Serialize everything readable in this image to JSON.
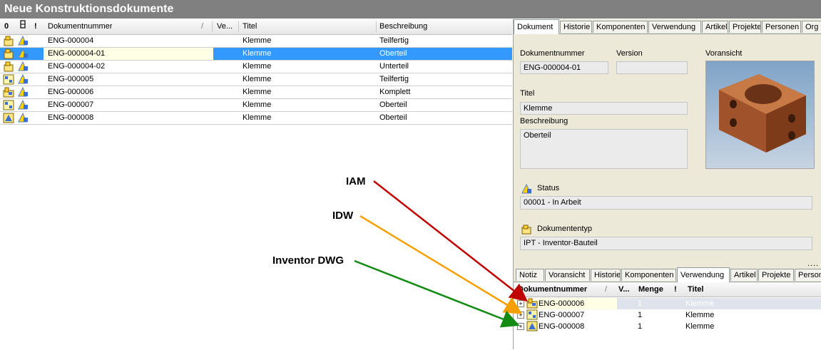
{
  "window": {
    "title": "Neue Konstruktionsdokumente"
  },
  "grid": {
    "headers": {
      "doknr": "Dokumentnummer",
      "version": "Ve...",
      "titel": "Titel",
      "beschreibung": "Beschreibung"
    },
    "rows": [
      {
        "doknr": "ENG-000004",
        "titel": "Klemme",
        "beschreibung": "Teilfertig",
        "type_icon": "ipt-part-icon",
        "status_icon": "status-in-work-icon",
        "selected": false
      },
      {
        "doknr": "ENG-000004-01",
        "titel": "Klemme",
        "beschreibung": "Oberteil",
        "type_icon": "ipt-part-icon",
        "status_icon": "status-in-work-icon",
        "selected": true
      },
      {
        "doknr": "ENG-000004-02",
        "titel": "Klemme",
        "beschreibung": "Unterteil",
        "type_icon": "ipt-part-icon",
        "status_icon": "status-in-work-icon",
        "selected": false
      },
      {
        "doknr": "ENG-000005",
        "titel": "Klemme",
        "beschreibung": "Teilfertig",
        "type_icon": "idw-drawing-icon",
        "status_icon": "status-in-work-icon",
        "selected": false
      },
      {
        "doknr": "ENG-000006",
        "titel": "Klemme",
        "beschreibung": "Komplett",
        "type_icon": "iam-assembly-icon",
        "status_icon": "status-in-work-icon",
        "selected": false
      },
      {
        "doknr": "ENG-000007",
        "titel": "Klemme",
        "beschreibung": "Oberteil",
        "type_icon": "idw-drawing-icon",
        "status_icon": "status-in-work-icon",
        "selected": false
      },
      {
        "doknr": "ENG-000008",
        "titel": "Klemme",
        "beschreibung": "Oberteil",
        "type_icon": "dwg-drawing-icon",
        "status_icon": "status-in-work-icon",
        "selected": false
      }
    ]
  },
  "top_tabs": [
    "Dokument",
    "Historie",
    "Komponenten",
    "Verwendung",
    "Artikel",
    "Projekte",
    "Personen",
    "Org"
  ],
  "detail": {
    "doknr_label": "Dokumentnummer",
    "doknr_value": "ENG-000004-01",
    "version_label": "Version",
    "version_value": "",
    "preview_label": "Voransicht",
    "titel_label": "Titel",
    "titel_value": "Klemme",
    "beschreibung_label": "Beschreibung",
    "beschreibung_value": "Oberteil",
    "status_label": "Status",
    "status_value": "00001 - In Arbeit",
    "doktyp_label": "Dokumententyp",
    "doktyp_value": "IPT - Inventor-Bauteil",
    "splitter": "...."
  },
  "bottom_tabs": [
    "Notiz",
    "Voransicht",
    "Historie",
    "Komponenten",
    "Verwendung",
    "Artikel",
    "Projekte",
    "Person"
  ],
  "usage": {
    "headers": {
      "doknr": "Dokumentnummer",
      "version": "V...",
      "menge": "Menge",
      "titel": "Titel"
    },
    "rows": [
      {
        "doknr": "ENG-000006",
        "menge": "1",
        "titel": "Klemme",
        "icon": "iam-assembly-icon",
        "selected": true
      },
      {
        "doknr": "ENG-000007",
        "menge": "1",
        "titel": "Klemme",
        "icon": "idw-drawing-icon",
        "selected": false
      },
      {
        "doknr": "ENG-000008",
        "menge": "1",
        "titel": "Klemme",
        "icon": "dwg-drawing-icon",
        "selected": false
      }
    ]
  },
  "annotations": {
    "iam": "IAM",
    "idw": "IDW",
    "dwg": "Inventor DWG"
  },
  "colors": {
    "iam_arrow": "#c00000",
    "idw_arrow": "#f5a000",
    "dwg_arrow": "#138a13",
    "selection": "#3399ff"
  }
}
